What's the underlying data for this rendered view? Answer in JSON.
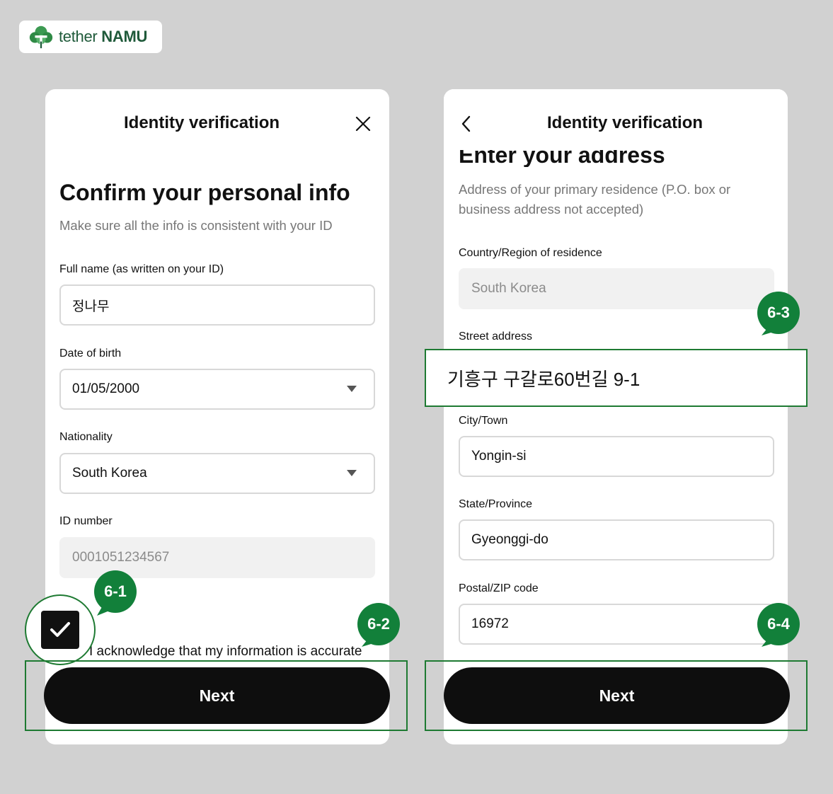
{
  "brand": {
    "name_light": "tether",
    "name_bold": "NAMU",
    "accent": "#1e7a32",
    "badge_color": "#12803a"
  },
  "left": {
    "title": "Identity verification",
    "heading": "Confirm your personal info",
    "subtitle": "Make sure all the info is consistent with your ID",
    "full_name": {
      "label": "Full name (as written on your ID)",
      "value": "정나무"
    },
    "dob": {
      "label": "Date of birth",
      "value": "01/05/2000"
    },
    "nationality": {
      "label": "Nationality",
      "value": "South Korea"
    },
    "id_number": {
      "label": "ID number",
      "value": "0001051234567"
    },
    "acknowledge": "I acknowledge that my information is accurate",
    "next": "Next"
  },
  "right": {
    "title": "Identity verification",
    "heading": "Enter your address",
    "subtitle": "Address of your primary residence (P.O. box or business address not accepted)",
    "country": {
      "label": "Country/Region of residence",
      "value": "South Korea"
    },
    "street": {
      "label": "Street address",
      "value": "기흥구 구갈로60번길 9-1"
    },
    "city": {
      "label": "City/Town",
      "value": "Yongin-si"
    },
    "state": {
      "label": "State/Province",
      "value": "Gyeonggi-do"
    },
    "postal": {
      "label": "Postal/ZIP code",
      "value": "16972"
    },
    "next": "Next"
  },
  "badges": {
    "b1": "6-1",
    "b2": "6-2",
    "b3": "6-3",
    "b4": "6-4"
  }
}
